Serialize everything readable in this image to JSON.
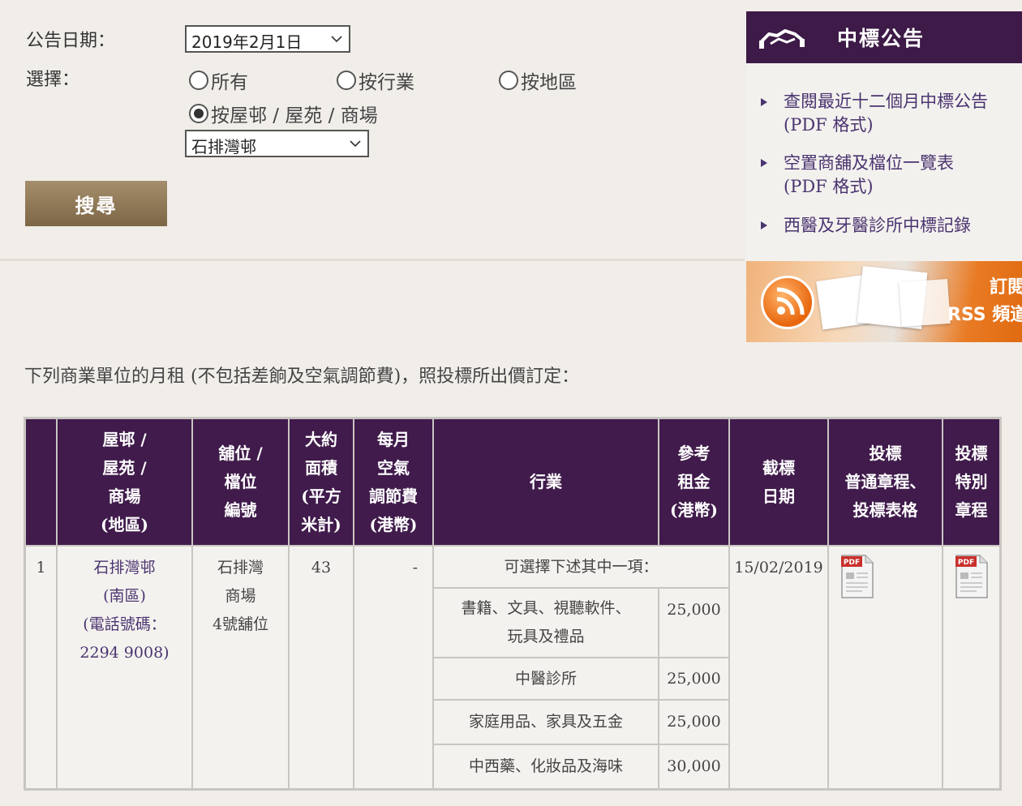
{
  "form": {
    "date_label": "公告日期：",
    "date_value": "2019年2月1日",
    "choose_label": "選擇：",
    "radios": [
      {
        "label": "所有",
        "checked": false
      },
      {
        "label": "按行業",
        "checked": false
      },
      {
        "label": "按地區",
        "checked": false
      },
      {
        "label": "按屋邨 / 屋苑 / 商場",
        "checked": true
      }
    ],
    "estate_value": "石排灣邨",
    "search_label": "搜尋"
  },
  "sidebar": {
    "title": "中標公告",
    "links": [
      {
        "line1": "查閱最近十二個月中標公告",
        "line2": "(PDF 格式)"
      },
      {
        "line1": "空置商舖及檔位一覽表",
        "line2": "(PDF 格式)"
      },
      {
        "line1": "西醫及牙醫診所中標記錄",
        "line2": ""
      }
    ],
    "rss_line1": "訂閱",
    "rss_line2": "RSS 頻道"
  },
  "note": "下列商業單位的月租 (不包括差餉及空氣調節費)，照投標所出價訂定：",
  "table": {
    "headers": {
      "estate": [
        "屋邨 /",
        "屋苑 /",
        "商場",
        "(地區)"
      ],
      "unit": [
        "舖位 /",
        "檔位",
        "編號"
      ],
      "area": [
        "大約",
        "面積",
        "(平方",
        "米計)"
      ],
      "ac_fee": [
        "每月",
        "空氣",
        "調節費",
        "(港幣)"
      ],
      "trade": [
        "行業"
      ],
      "rent": [
        "參考",
        "租金",
        "(港幣)"
      ],
      "deadline": [
        "截標",
        "日期"
      ],
      "general": [
        "投標",
        "普通章程、",
        "投標表格"
      ],
      "special": [
        "投標",
        "特別",
        "章程"
      ]
    },
    "row": {
      "index": "1",
      "estate": [
        "石排灣邨",
        "(南區)",
        "(電話號碼：",
        "2294 9008)"
      ],
      "unit": [
        "石排灣",
        "商場",
        "4號舖位"
      ],
      "area": "43",
      "ac_fee": "-",
      "trade_intro": "可選擇下述其中一項：",
      "trades": [
        {
          "name": [
            "書籍、文具、視聽軟件、",
            "玩具及禮品"
          ],
          "rent": "25,000"
        },
        {
          "name": [
            "中醫診所"
          ],
          "rent": "25,000"
        },
        {
          "name": [
            "家庭用品、家具及五金"
          ],
          "rent": "25,000"
        },
        {
          "name": [
            "中西藥、化妝品及海味"
          ],
          "rent": "30,000"
        }
      ],
      "deadline": "15/02/2019",
      "pdf_label": "PDF"
    }
  },
  "colors": {
    "header_purple": "#401b4b",
    "link_purple": "#4a3470",
    "page_bg": "#f1eeea",
    "button_brown": "#8f7856"
  }
}
